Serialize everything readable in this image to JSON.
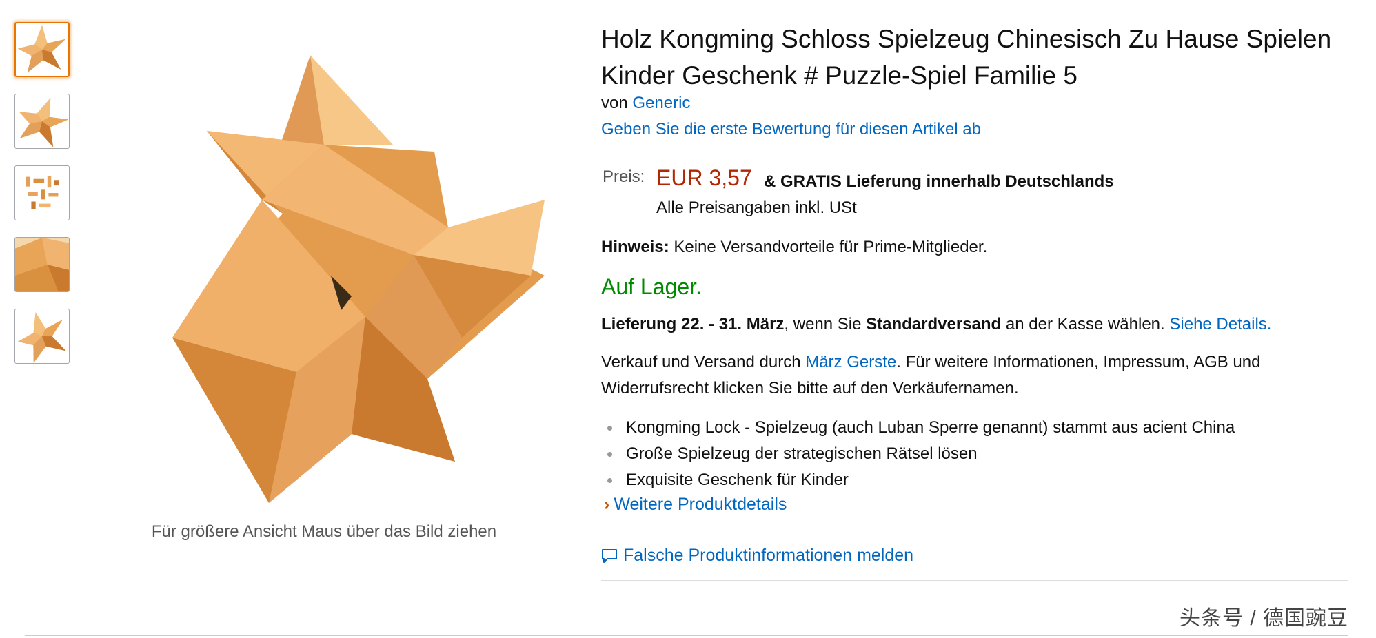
{
  "thumbnails": [
    "star-puzzle-view-1",
    "star-puzzle-view-2",
    "puzzle-pieces",
    "star-puzzle-closeup",
    "star-puzzle-view-3"
  ],
  "image_caption": "Für größere Ansicht Maus über das Bild ziehen",
  "product": {
    "title": "Holz Kongming Schloss Spielzeug Chinesisch Zu Hause Spielen Kinder Geschenk # Puzzle-Spiel Familie 5",
    "by_prefix": "von",
    "brand": "Generic",
    "review_link": "Geben Sie die erste Bewertung für diesen Artikel ab"
  },
  "price": {
    "label": "Preis:",
    "value": "EUR 3,57",
    "amp": "&",
    "shipping": "GRATIS Lieferung innerhalb Deutschlands",
    "vat_note": "Alle Preisangaben inkl. USt"
  },
  "notice": {
    "label": "Hinweis:",
    "text": "Keine Versandvorteile für Prime-Mitglieder."
  },
  "stock": "Auf Lager.",
  "delivery": {
    "bold1": "Lieferung 22. - 31. März",
    "text1": ", wenn Sie ",
    "bold2": "Standardversand",
    "text2": " an der Kasse wählen. ",
    "link": "Siehe Details."
  },
  "seller": {
    "prefix": "Verkauf und Versand durch ",
    "name": "März Gerste",
    "suffix": ". Für weitere Informationen, Impressum, AGB und Widerrufsrecht klicken Sie bitte auf den Verkäufernamen."
  },
  "features": [
    "Kongming Lock - Spielzeug (auch Luban Sperre genannt) stammt aus acient China",
    "Große Spielzeug der strategischen Rätsel lösen",
    "Exquisite Geschenk für Kinder"
  ],
  "more_details": "Weitere Produktdetails",
  "report_link": "Falsche Produktinformationen melden",
  "watermark": "头条号 / 德国豌豆",
  "colors": {
    "link": "#0066c0",
    "price": "#b12704",
    "in_stock": "#008a00",
    "selected_thumb": "#e77600"
  }
}
